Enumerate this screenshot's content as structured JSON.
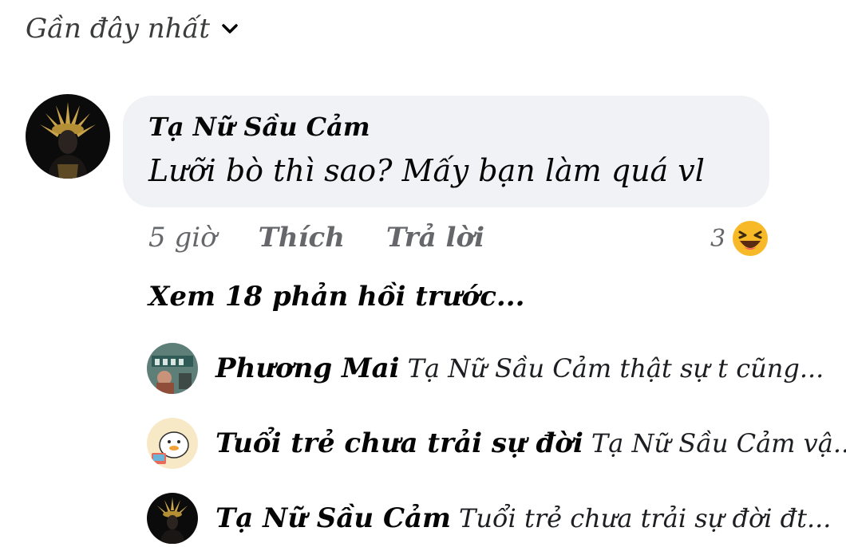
{
  "sort": {
    "label": "Gần đây nhất",
    "icon": "chevron-down-icon"
  },
  "comment": {
    "author": "Tạ Nữ Sầu Cảm",
    "text": "Lưỡi bò thì sao? Mấy bạn làm quá vl",
    "time": "5 giờ",
    "like_label": "Thích",
    "reply_label": "Trả lời",
    "reaction_count": "3",
    "reaction_icon": "haha-emoji-icon"
  },
  "view_previous": "Xem 18 phản hồi trước...",
  "replies": [
    {
      "author": "Phương Mai",
      "text": "Tạ Nữ Sầu Cảm  thật sự t cũng..."
    },
    {
      "author": "Tuổi trẻ chưa trải sự đời",
      "text": "Tạ Nữ Sầu Cảm vậ..."
    },
    {
      "author": "Tạ Nữ Sầu Cảm",
      "text": "Tuổi trẻ chưa trải sự đời  đt..."
    }
  ],
  "colors": {
    "bubble_bg": "#f0f2f5",
    "secondary_text": "#65676b",
    "reaction_yellow": "#f7b928"
  }
}
